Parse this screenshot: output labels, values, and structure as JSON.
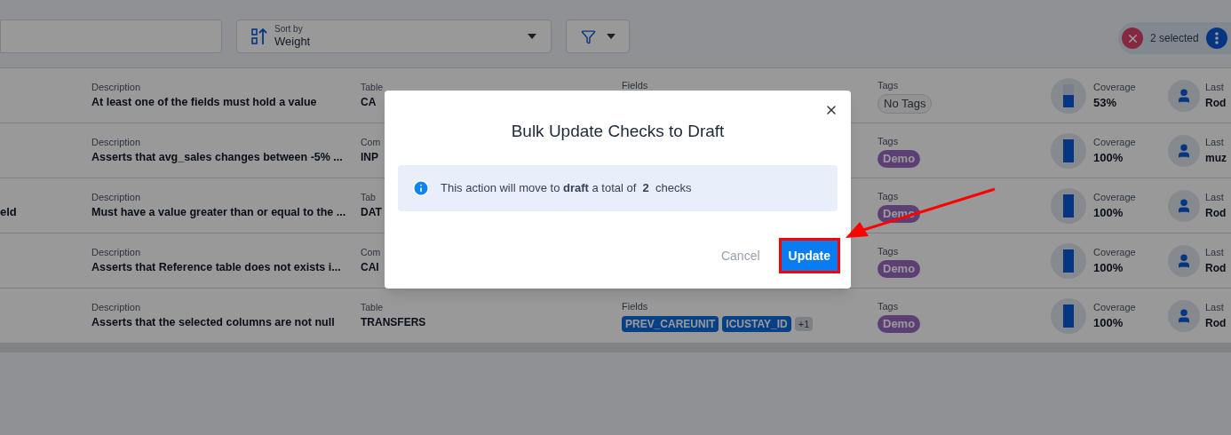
{
  "toolbar": {
    "sort": {
      "label": "Sort by",
      "value": "Weight"
    },
    "selection": {
      "count": "2 selected"
    }
  },
  "rows": [
    {
      "description_label": "Description",
      "description": "At least one of the fields must hold a value",
      "column_3_label": "Table",
      "column_3": "CA",
      "fields_label": "Fields",
      "fields": [],
      "tags_label": "Tags",
      "tags": [
        {
          "label": "No Tags",
          "kind": "empty"
        }
      ],
      "coverage_label": "Coverage",
      "coverage": "53%",
      "level": 0.53,
      "last_label": "Last",
      "last": "Rod"
    },
    {
      "description_label": "Description",
      "description": "Asserts that avg_sales changes between -5% ...",
      "column_3_label": "Com",
      "column_3": "INP",
      "tags_label": "Tags",
      "tags": [
        {
          "label": "Demo",
          "kind": "tag"
        }
      ],
      "coverage_label": "Coverage",
      "coverage": "100%",
      "level": 1,
      "last_label": "Last",
      "last": "muz"
    },
    {
      "column_1": "eld",
      "description_label": "Description",
      "description": "Must have a value greater than or equal to the ...",
      "column_3_label": "Tab",
      "column_3": "DAT",
      "tags_label": "Tags",
      "tags": [
        {
          "label": "Demo",
          "kind": "tag"
        }
      ],
      "coverage_label": "Coverage",
      "coverage": "100%",
      "level": 1,
      "last_label": "Last",
      "last": "Rod"
    },
    {
      "description_label": "Description",
      "description": "Asserts that Reference table does not exists i...",
      "column_3_label": "Com",
      "column_3": "CAI",
      "tags_label": "Tags",
      "tags": [
        {
          "label": "Demo",
          "kind": "tag"
        }
      ],
      "coverage_label": "Coverage",
      "coverage": "100%",
      "level": 1,
      "last_label": "Last",
      "last": "Rod"
    },
    {
      "description_label": "Description",
      "description": "Asserts that the selected columns are not null",
      "column_3_label": "Table",
      "column_3": "TRANSFERS",
      "fields_label": "Fields",
      "fields": [
        {
          "label": "PREV_CAREUNIT",
          "kind": "field"
        },
        {
          "label": "ICUSTAY_ID",
          "kind": "field"
        },
        {
          "label": "+1",
          "kind": "more"
        }
      ],
      "tags_label": "Tags",
      "tags": [
        {
          "label": "Demo",
          "kind": "tag"
        }
      ],
      "coverage_label": "Coverage",
      "coverage": "100%",
      "level": 1,
      "last_label": "Last",
      "last": "Rod"
    }
  ],
  "dialog": {
    "title": "Bulk Update Checks to Draft",
    "message": "This action will move to **draft** a total of  **2**  checks",
    "buttons": [
      {
        "label": "Cancel",
        "kind": "secondary",
        "highlighted": false
      },
      {
        "label": "Update",
        "kind": "primary",
        "highlighted": true
      }
    ]
  }
}
